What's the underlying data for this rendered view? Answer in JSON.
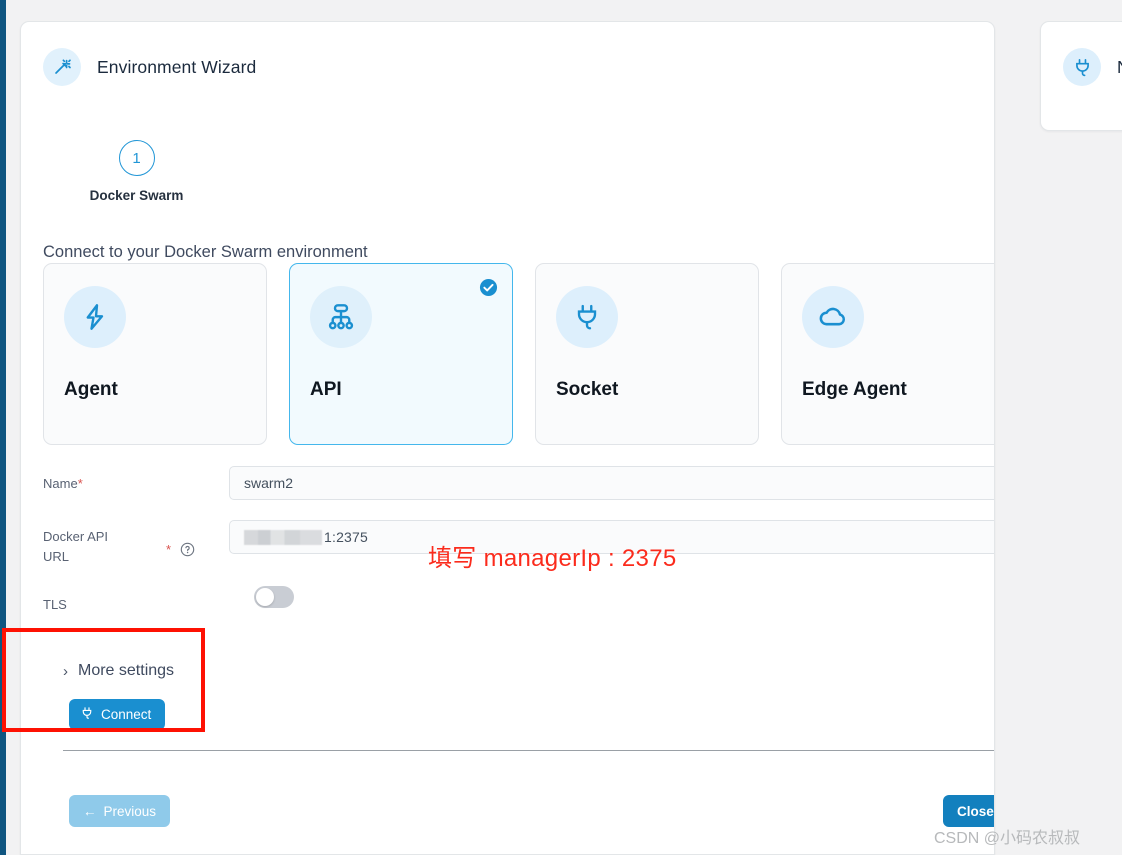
{
  "app": {
    "rail_color": "#0f5580",
    "background": "#f2f2f3"
  },
  "wizard": {
    "icon": "magic-wand-icon",
    "title": "Environment Wizard",
    "stepper": {
      "number": "1",
      "label": "Docker Swarm"
    },
    "section_heading": "Connect to your Docker Swarm environment",
    "options": [
      {
        "name": "Agent",
        "icon": "bolt-icon",
        "selected": false
      },
      {
        "name": "API",
        "icon": "sitemap-icon",
        "selected": true
      },
      {
        "name": "Socket",
        "icon": "plug-icon",
        "selected": false
      },
      {
        "name": "Edge Agent",
        "icon": "cloud-icon",
        "selected": false
      }
    ],
    "form": {
      "name_label": "Name",
      "name_required": "*",
      "name_value": "swarm2",
      "name_placeholder": "",
      "url_label_line1": "Docker API",
      "url_label_line2": "URL",
      "url_required": "*",
      "url_help_icon": "question-circle-icon",
      "url_value_suffix": "1:2375",
      "url_value_redacted": true,
      "tls_label": "TLS",
      "tls_enabled": false
    },
    "more_settings_label": "More settings",
    "more_settings_chevron": "chevron-right-icon",
    "connect_label": "Connect",
    "connect_icon": "plug-icon",
    "footer": {
      "previous_label": "Previous",
      "previous_icon": "arrow-left-icon",
      "close_label": "Close",
      "close_icon": "arrow-right-icon"
    }
  },
  "side_card": {
    "icon": "plug-icon",
    "title": "N"
  },
  "annotations": {
    "note_text": "填写 managerIp : 2375",
    "note_color": "#fb2b1c",
    "highlight_box_color": "#fe1103",
    "watermark": "CSDN @小码农叔叔"
  },
  "colors": {
    "primary": "#1380be",
    "accent_light": "#44b7ec",
    "selected_card_bg": "#f2fafe"
  }
}
